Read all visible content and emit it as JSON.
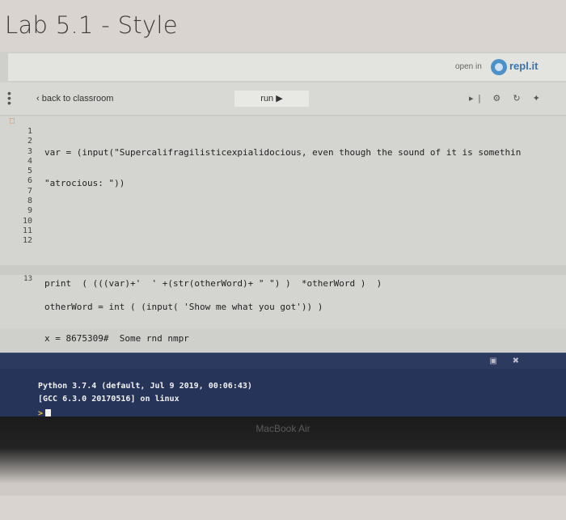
{
  "page": {
    "title": "Lab 5.1 - Style"
  },
  "replit_bar": {
    "open_in": "open in",
    "brand": "repl.it"
  },
  "nav": {
    "back": "‹ back to classroom",
    "run": "run ▶",
    "icons": "▸| ⚙ ↻ ✦"
  },
  "editor": {
    "line_numbers": [
      "1",
      "2",
      "3",
      "4",
      "5",
      "6",
      "7",
      "8",
      "9",
      "10",
      "11",
      "12",
      "13"
    ],
    "lines": [
      "var = (input(\"Supercalifragilisticexpialidocious, even though the sound of it is somethin",
      "\"atrocious: \"))",
      "",
      "",
      "",
      "otherWord = int ( (input( 'Show me what you got')) )",
      "x = 8675309#  Some rnd nmpr",
      "",
      "",
      "",
      "",
      "",
      "print  ( (((var)+'  ' +(str(otherWord)+ \" \") )  *otherWord )  )"
    ]
  },
  "console": {
    "line1": "Python 3.7.4 (default, Jul  9 2019, 00:06:43)",
    "line2": "[GCC 6.3.0 20170516] on linux",
    "prompt": ">"
  },
  "device": {
    "brand": "MacBook Air"
  }
}
